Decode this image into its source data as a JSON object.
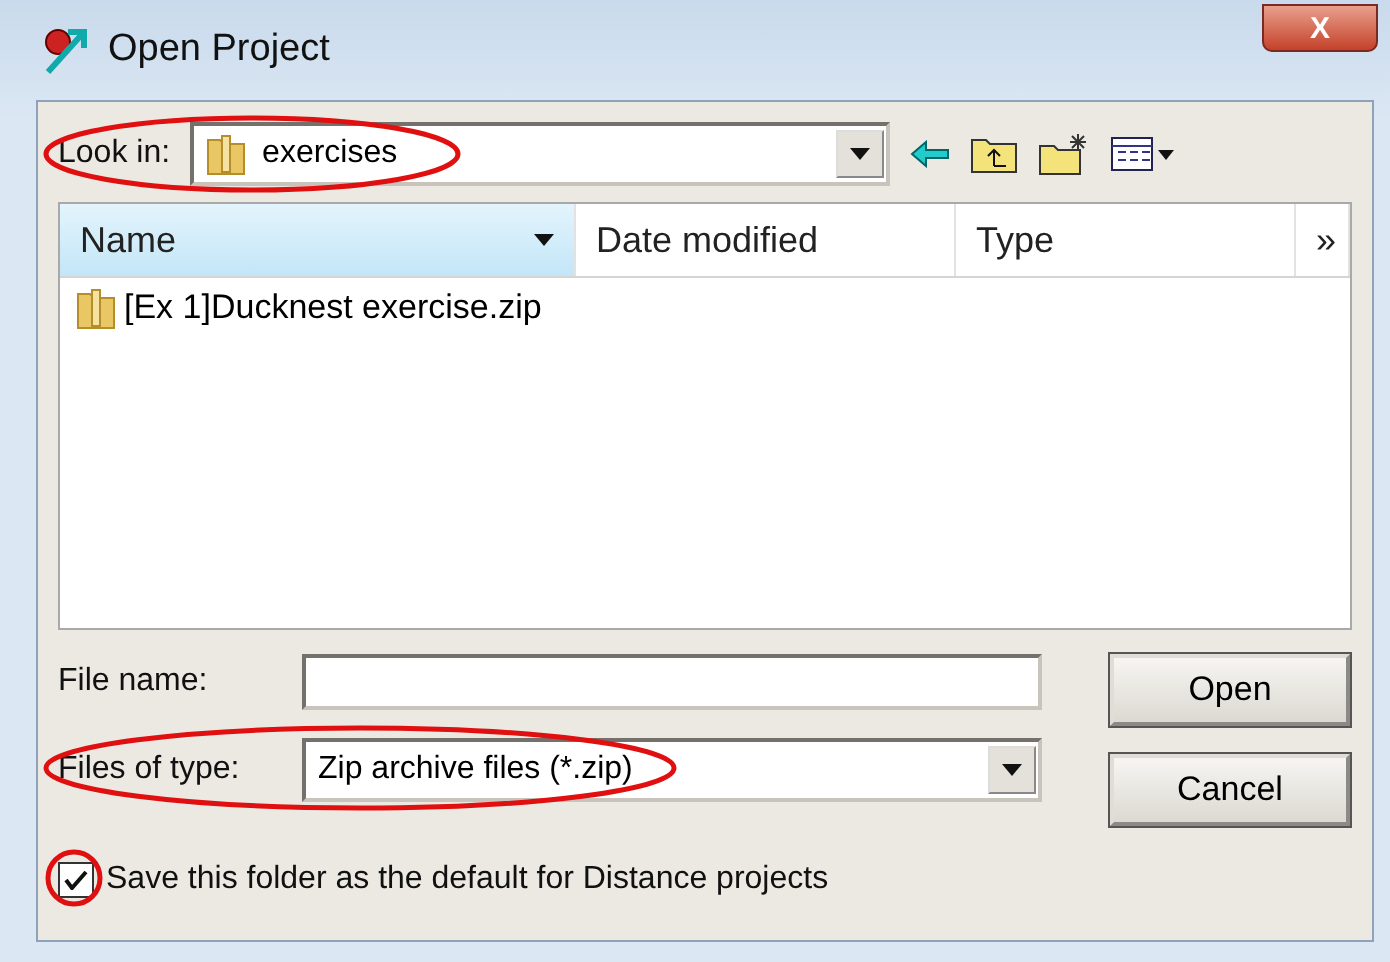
{
  "window": {
    "title": "Open Project",
    "close": "X"
  },
  "look_in": {
    "label": "Look in:",
    "value": "exercises",
    "circled": true
  },
  "columns": [
    {
      "label": "Name",
      "selected": true,
      "menu": true
    },
    {
      "label": "Date modified",
      "selected": false,
      "menu": false
    },
    {
      "label": "Type",
      "selected": false,
      "menu": false
    },
    {
      "label": "»",
      "selected": false,
      "menu": false
    }
  ],
  "files": [
    {
      "name": "[Ex 1]Ducknest exercise.zip",
      "selected": false
    }
  ],
  "file_name": {
    "label": "File name:"
  },
  "files_of_type": {
    "label": "Files of type:",
    "value": "Zip archive files (*.zip)",
    "circled": true
  },
  "buttons": [
    "Open",
    "Cancel"
  ],
  "save_default": {
    "label": "Save this folder as the default for Distance projects",
    "checked": true,
    "circled": true
  }
}
